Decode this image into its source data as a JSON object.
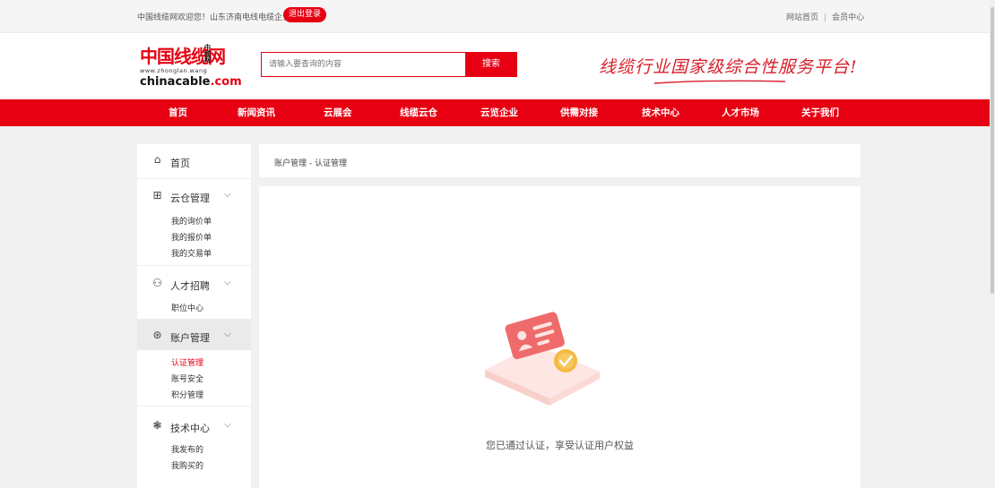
{
  "topbar": {
    "welcome": "中国线缆网欢迎您！山东济南电线电缆企业",
    "logout": "退出登录",
    "site_home": "网站首页",
    "separator": "|",
    "member_center": "会员中心"
  },
  "header": {
    "logo_cn": "中国线缆网",
    "logo_side": [
      "中",
      "缆",
      "网"
    ],
    "logo_url": "www.zhonglan.wang",
    "logo_en_main": "chinacable",
    "logo_en_suffix": ".com",
    "search_placeholder": "请输入要查询的内容",
    "search_button": "搜索",
    "slogan": "线缆行业国家级综合性服务平台!"
  },
  "nav": [
    "首页",
    "新闻资讯",
    "云展会",
    "线缆云仓",
    "云览企业",
    "供需对接",
    "技术中心",
    "人才市场",
    "关于我们"
  ],
  "sidebar": {
    "home": {
      "label": "首页",
      "icon": "home-icon"
    },
    "groups": [
      {
        "label": "云仓管理",
        "icon": "grid-icon",
        "items": [
          "我的询价单",
          "我的报价单",
          "我的交易单"
        ]
      },
      {
        "label": "人才招聘",
        "icon": "person-icon",
        "items": [
          "职位中心"
        ]
      },
      {
        "label": "账户管理",
        "icon": "account-icon",
        "items": [
          "认证管理",
          "账号安全",
          "积分管理"
        ]
      },
      {
        "label": "技术中心",
        "icon": "tech-icon",
        "items": [
          "我发布的",
          "我购买的"
        ]
      }
    ],
    "active_group": "账户管理",
    "active_item": "认证管理"
  },
  "breadcrumb": "账户管理 - 认证管理",
  "content": {
    "message": "您已通过认证，享受认证用户权益"
  },
  "colors": {
    "brand_red": "#e60012",
    "page_bg": "#f1f1f1"
  }
}
